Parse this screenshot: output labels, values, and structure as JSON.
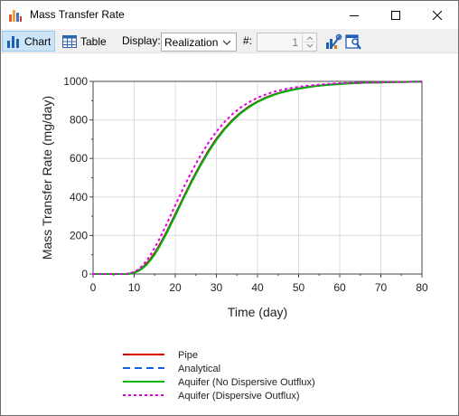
{
  "window": {
    "title": "Mass Transfer Rate"
  },
  "toolbar": {
    "chart_label": "Chart",
    "table_label": "Table",
    "display_label": "Display:",
    "display_value": "Realization",
    "number_label": "#:",
    "number_value": "1"
  },
  "colors": {
    "pipe": "#dd0000",
    "analytical": "#1060e0",
    "aquifer_no_disp": "#00b400",
    "aquifer_disp": "#e000e0"
  },
  "chart_data": {
    "type": "line",
    "title": "",
    "xlabel": "Time (day)",
    "ylabel": "Mass Transfer Rate (mg/day)",
    "xlim": [
      0,
      80
    ],
    "ylim": [
      0,
      1000
    ],
    "xticks": [
      "0",
      "10",
      "20",
      "30",
      "40",
      "50",
      "60",
      "70",
      "80"
    ],
    "yticks": [
      "0",
      "200",
      "400",
      "600",
      "800",
      "1000"
    ],
    "grid": true,
    "legend_position": "bottom",
    "x": [
      0,
      5,
      8,
      9,
      10,
      11,
      12,
      13,
      14,
      15,
      16,
      17,
      18,
      19,
      20,
      22,
      24,
      26,
      28,
      30,
      32,
      34,
      36,
      38,
      40,
      42,
      44,
      46,
      48,
      50,
      52,
      54,
      56,
      58,
      60,
      62,
      64,
      66,
      68,
      70,
      72,
      74,
      76,
      78,
      80
    ],
    "series": [
      {
        "name": "Pipe",
        "style": "solid",
        "color": "#dd0000",
        "values": [
          0,
          0,
          0,
          3,
          8,
          18,
          33,
          54,
          80,
          110,
          145,
          183,
          224,
          267,
          311,
          399,
          485,
          565,
          638,
          702,
          756,
          802,
          840,
          871,
          896,
          916,
          932,
          945,
          955,
          963,
          970,
          976,
          980,
          984,
          987,
          989,
          991,
          993,
          994,
          995,
          996,
          997,
          997,
          998,
          998
        ]
      },
      {
        "name": "Analytical",
        "style": "dashed",
        "color": "#1060e0",
        "values": [
          0,
          0,
          0,
          2,
          7,
          16,
          30,
          50,
          75,
          105,
          140,
          178,
          219,
          262,
          306,
          395,
          481,
          561,
          634,
          698,
          753,
          799,
          838,
          869,
          894,
          914,
          931,
          944,
          954,
          963,
          970,
          975,
          980,
          984,
          987,
          989,
          991,
          993,
          994,
          995,
          996,
          997,
          997,
          998,
          998
        ]
      },
      {
        "name": "Aquifer (No Dispersive Outflux)",
        "style": "solid",
        "color": "#00b400",
        "values": [
          0,
          0,
          0,
          2,
          6,
          15,
          29,
          48,
          73,
          102,
          137,
          175,
          216,
          259,
          303,
          392,
          478,
          558,
          631,
          696,
          751,
          797,
          836,
          867,
          893,
          913,
          930,
          943,
          953,
          962,
          969,
          975,
          980,
          983,
          986,
          989,
          991,
          993,
          994,
          995,
          996,
          997,
          997,
          998,
          998
        ]
      },
      {
        "name": "Aquifer (Dispersive Outflux)",
        "style": "dotted",
        "color": "#e000e0",
        "values": [
          0,
          0,
          0,
          4,
          11,
          24,
          43,
          69,
          100,
          136,
          176,
          219,
          264,
          310,
          357,
          448,
          533,
          611,
          680,
          740,
          790,
          832,
          866,
          893,
          915,
          932,
          946,
          957,
          965,
          972,
          977,
          981,
          985,
          988,
          990,
          992,
          993,
          994,
          995,
          996,
          997,
          997,
          998,
          998,
          999
        ]
      }
    ]
  }
}
